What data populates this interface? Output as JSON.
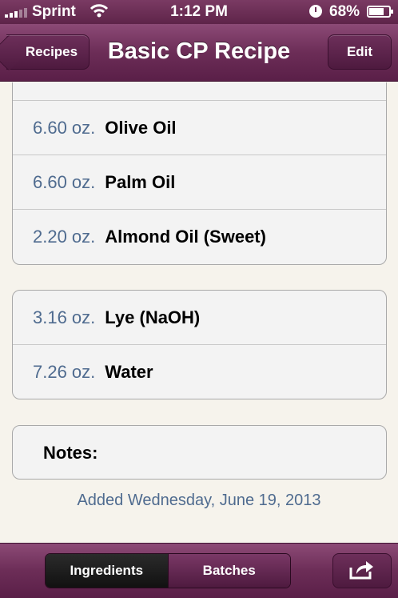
{
  "status_bar": {
    "carrier": "Sprint",
    "time": "1:12 PM",
    "battery": "68%"
  },
  "nav": {
    "back_label": "Recipes",
    "title": "Basic CP Recipe",
    "edit_label": "Edit"
  },
  "oils": [
    {
      "amount": "6.60 oz.",
      "name": "Olive Oil"
    },
    {
      "amount": "6.60 oz.",
      "name": "Palm Oil"
    },
    {
      "amount": "2.20 oz.",
      "name": "Almond Oil (Sweet)"
    }
  ],
  "lye_water": [
    {
      "amount": "3.16 oz.",
      "name": "Lye (NaOH)"
    },
    {
      "amount": "7.26 oz.",
      "name": "Water"
    }
  ],
  "notes_label": "Notes:",
  "added_text": "Added Wednesday, June 19, 2013",
  "tabs": {
    "ingredients_label": "Ingredients",
    "batches_label": "Batches",
    "active": "Ingredients"
  },
  "icons": {
    "signal": "signal-bars-icon",
    "wifi": "wifi-icon",
    "clock": "clock-icon",
    "battery": "battery-icon",
    "share": "share-icon"
  },
  "colors": {
    "bar": "#6c2d57",
    "amount_text": "#4f6b8f"
  }
}
